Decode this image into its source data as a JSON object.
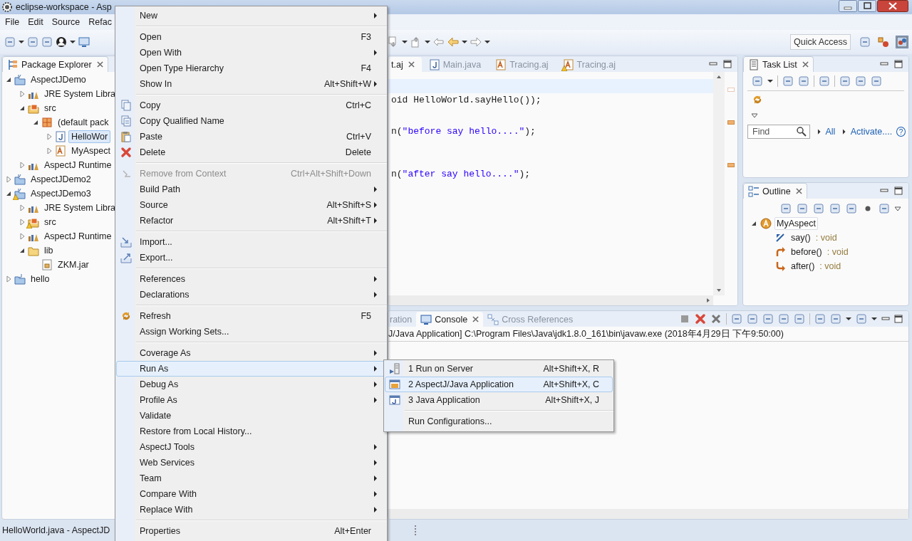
{
  "window": {
    "title": "eclipse-workspace - Asp"
  },
  "menubar": [
    "File",
    "Edit",
    "Source",
    "Refac"
  ],
  "toolbar": {
    "quick_access": "Quick Access"
  },
  "package_explorer": {
    "title": "Package Explorer",
    "tree": [
      {
        "label": "AspectJDemo",
        "kind": "aj-project",
        "expanded": true,
        "warning": false,
        "selected": false,
        "children": [
          {
            "label": "JRE System Libra",
            "kind": "library",
            "expanded": false,
            "warning": false,
            "selected": false
          },
          {
            "label": "src",
            "kind": "source-folder",
            "expanded": true,
            "warning": false,
            "selected": false,
            "children": [
              {
                "label": "(default pack",
                "kind": "package",
                "expanded": true,
                "warning": false,
                "selected": false,
                "children": [
                  {
                    "label": "HelloWor",
                    "kind": "java-file",
                    "expanded": false,
                    "warning": false,
                    "selected": true
                  },
                  {
                    "label": "MyAspect",
                    "kind": "aspect-file",
                    "expanded": false,
                    "warning": false,
                    "selected": false
                  }
                ]
              }
            ]
          },
          {
            "label": "AspectJ Runtime",
            "kind": "library",
            "expanded": false,
            "warning": false,
            "selected": false
          }
        ]
      },
      {
        "label": "AspectJDemo2",
        "kind": "aj-project",
        "expanded": false,
        "warning": false,
        "selected": false
      },
      {
        "label": "AspectJDemo3",
        "kind": "aj-project",
        "expanded": true,
        "warning": true,
        "selected": false,
        "children": [
          {
            "label": "JRE System Libra",
            "kind": "library",
            "expanded": false,
            "warning": false,
            "selected": false
          },
          {
            "label": "src",
            "kind": "source-folder",
            "expanded": false,
            "warning": true,
            "selected": false
          },
          {
            "label": "AspectJ Runtime",
            "kind": "library",
            "expanded": false,
            "warning": false,
            "selected": false
          },
          {
            "label": "lib",
            "kind": "folder",
            "expanded": true,
            "warning": false,
            "selected": false,
            "children": [
              {
                "label": "ZKM.jar",
                "kind": "jar",
                "warning": false,
                "selected": false
              }
            ]
          }
        ]
      },
      {
        "label": "hello",
        "kind": "java-project",
        "expanded": false,
        "warning": false,
        "selected": false
      }
    ]
  },
  "editor": {
    "tabs": [
      {
        "label": "t.aj",
        "kind": "aspect",
        "selected": true,
        "warning": false
      },
      {
        "label": "Main.java",
        "kind": "java",
        "selected": false,
        "warning": false
      },
      {
        "label": "Tracing.aj",
        "kind": "aspect",
        "selected": false,
        "warning": false
      },
      {
        "label": "Tracing.aj",
        "kind": "aspect",
        "selected": false,
        "warning": true
      }
    ],
    "lines": [
      {
        "segments": [
          {
            "text": "oid HelloWorld.sayHello());",
            "kind": "plain"
          }
        ]
      },
      {
        "segments": [
          {
            "text": "n(",
            "kind": "plain"
          },
          {
            "text": "\"before say hello....\"",
            "kind": "string"
          },
          {
            "text": ");",
            "kind": "plain"
          }
        ]
      },
      {
        "segments": [
          {
            "text": "n(",
            "kind": "plain"
          },
          {
            "text": "\"after say hello....\"",
            "kind": "string"
          },
          {
            "text": ");",
            "kind": "plain"
          }
        ]
      }
    ]
  },
  "task_list": {
    "title": "Task List",
    "find_placeholder": "Find",
    "links": [
      "All",
      "Activate...."
    ],
    "help": "?"
  },
  "outline": {
    "title": "Outline",
    "tree": [
      {
        "label": "MyAspect",
        "kind": "aspect",
        "selected": true,
        "children": [
          {
            "label": "say()",
            "type": ": void",
            "kind": "pointcut",
            "selected": false
          },
          {
            "label": "before()",
            "type": ": void",
            "kind": "before-advice",
            "selected": false
          },
          {
            "label": "after()",
            "type": ": void",
            "kind": "after-advice",
            "selected": false
          }
        ]
      }
    ]
  },
  "console": {
    "tabs": [
      {
        "label": "ration",
        "selected": false
      },
      {
        "label": "Console",
        "selected": true
      },
      {
        "label": "Cross References",
        "selected": false
      }
    ],
    "line": "J/Java Application] C:\\Program Files\\Java\\jdk1.8.0_161\\bin\\javaw.exe (2018年4月29日 下午9:50:00)"
  },
  "status_bar": "HelloWorld.java - AspectJD",
  "context_menu": {
    "groups": [
      [
        {
          "label": "New",
          "has_submenu": true,
          "disabled": false,
          "selected": false
        }
      ],
      [
        {
          "label": "Open",
          "shortcut": "F3",
          "has_submenu": false,
          "disabled": false,
          "selected": false
        },
        {
          "label": "Open With",
          "has_submenu": true,
          "disabled": false,
          "selected": false
        },
        {
          "label": "Open Type Hierarchy",
          "shortcut": "F4",
          "has_submenu": false,
          "disabled": false,
          "selected": false
        },
        {
          "label": "Show In",
          "shortcut": "Alt+Shift+W",
          "has_submenu": true,
          "disabled": false,
          "selected": false
        }
      ],
      [
        {
          "label": "Copy",
          "shortcut": "Ctrl+C",
          "has_submenu": false,
          "disabled": false,
          "selected": false
        },
        {
          "label": "Copy Qualified Name",
          "has_submenu": false,
          "disabled": false,
          "selected": false
        },
        {
          "label": "Paste",
          "shortcut": "Ctrl+V",
          "has_submenu": false,
          "disabled": false,
          "selected": false
        },
        {
          "label": "Delete",
          "shortcut": "Delete",
          "has_submenu": false,
          "disabled": false,
          "selected": false
        }
      ],
      [
        {
          "label": "Remove from Context",
          "shortcut": "Ctrl+Alt+Shift+Down",
          "has_submenu": false,
          "disabled": true,
          "selected": false
        },
        {
          "label": "Build Path",
          "has_submenu": true,
          "disabled": false,
          "selected": false
        },
        {
          "label": "Source",
          "shortcut": "Alt+Shift+S",
          "has_submenu": true,
          "disabled": false,
          "selected": false
        },
        {
          "label": "Refactor",
          "shortcut": "Alt+Shift+T",
          "has_submenu": true,
          "disabled": false,
          "selected": false
        }
      ],
      [
        {
          "label": "Import...",
          "has_submenu": false,
          "disabled": false,
          "selected": false
        },
        {
          "label": "Export...",
          "has_submenu": false,
          "disabled": false,
          "selected": false
        }
      ],
      [
        {
          "label": "References",
          "has_submenu": true,
          "disabled": false,
          "selected": false
        },
        {
          "label": "Declarations",
          "has_submenu": true,
          "disabled": false,
          "selected": false
        }
      ],
      [
        {
          "label": "Refresh",
          "shortcut": "F5",
          "has_submenu": false,
          "disabled": false,
          "selected": false
        },
        {
          "label": "Assign Working Sets...",
          "has_submenu": false,
          "disabled": false,
          "selected": false
        }
      ],
      [
        {
          "label": "Coverage As",
          "has_submenu": true,
          "disabled": false,
          "selected": false
        },
        {
          "label": "Run As",
          "has_submenu": true,
          "disabled": false,
          "selected": true
        },
        {
          "label": "Debug As",
          "has_submenu": true,
          "disabled": false,
          "selected": false
        },
        {
          "label": "Profile As",
          "has_submenu": true,
          "disabled": false,
          "selected": false
        },
        {
          "label": "Validate",
          "has_submenu": false,
          "disabled": false,
          "selected": false
        },
        {
          "label": "Restore from Local History...",
          "has_submenu": false,
          "disabled": false,
          "selected": false
        },
        {
          "label": "AspectJ Tools",
          "has_submenu": true,
          "disabled": false,
          "selected": false
        },
        {
          "label": "Web Services",
          "has_submenu": true,
          "disabled": false,
          "selected": false
        },
        {
          "label": "Team",
          "has_submenu": true,
          "disabled": false,
          "selected": false
        },
        {
          "label": "Compare With",
          "has_submenu": true,
          "disabled": false,
          "selected": false
        },
        {
          "label": "Replace With",
          "has_submenu": true,
          "disabled": false,
          "selected": false
        }
      ],
      [
        {
          "label": "Properties",
          "shortcut": "Alt+Enter",
          "has_submenu": false,
          "disabled": false,
          "selected": false
        }
      ]
    ]
  },
  "run_as_submenu": {
    "groups": [
      [
        {
          "label": "1 Run on Server",
          "shortcut": "Alt+Shift+X, R",
          "selected": false
        },
        {
          "label": "2 AspectJ/Java Application",
          "shortcut": "Alt+Shift+X, C",
          "selected": true
        },
        {
          "label": "3 Java Application",
          "shortcut": "Alt+Shift+X, J",
          "selected": false
        }
      ],
      [
        {
          "label": "Run Configurations...",
          "selected": false
        }
      ]
    ]
  }
}
